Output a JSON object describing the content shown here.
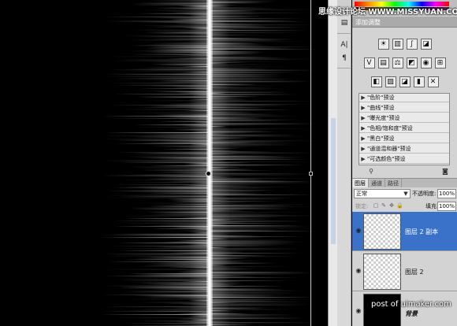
{
  "watermarks": {
    "top": "思缘设计论坛 WWW.MISSYUAN.COM",
    "bottom": "post of uimaker.com"
  },
  "adjustments": {
    "title": "添加调整",
    "presets": [
      "\"色阶\"预设",
      "\"曲线\"预设",
      "\"曝光度\"预设",
      "\"色相/饱和度\"预设",
      "\"黑白\"预设",
      "\"通道混和器\"预设",
      "\"可选颜色\"预设"
    ]
  },
  "layers_panel": {
    "tabs": [
      "图层",
      "通道",
      "路径"
    ],
    "blend_mode": "正常",
    "opacity_label": "不透明度:",
    "opacity_value": "100%",
    "lock_label": "锁定:",
    "fill_label": "填充:",
    "fill_value": "100%",
    "layers": [
      {
        "name": "图层 2 副本",
        "selected": true,
        "visible": true
      },
      {
        "name": "图层 2",
        "selected": false,
        "visible": true
      },
      {
        "name": "背景",
        "selected": false,
        "visible": true
      }
    ]
  },
  "icons": {
    "eye": "eye-icon",
    "preset_arrow": "triangle-right-icon",
    "dropdown": "chevron-down-icon"
  },
  "colors": {
    "selected_layer": "#3a72c9",
    "panel_bg": "#d3d3d3",
    "canvas_bg": "#000000"
  }
}
